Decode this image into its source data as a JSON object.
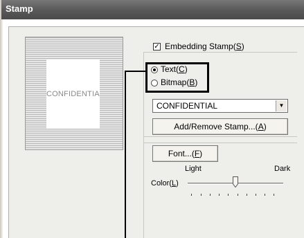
{
  "window": {
    "title": "Stamp"
  },
  "preview": {
    "text": "CONFIDENTIA"
  },
  "embedding": {
    "label_prefix": "Embedding Stamp(",
    "label_key": "S",
    "label_suffix": ")",
    "checked": true
  },
  "stamp_type": {
    "text_option": {
      "prefix": "Text(",
      "key": "C",
      "suffix": ")",
      "selected": true
    },
    "bitmap_option": {
      "prefix": "Bitmap(",
      "key": "B",
      "suffix": ")",
      "selected": false
    }
  },
  "stamp_select": {
    "value": "CONFIDENTIAL"
  },
  "add_remove_button": {
    "prefix": "Add/Remove Stamp...(",
    "key": "A",
    "suffix": ")"
  },
  "font_button": {
    "prefix": "Font...(",
    "key": "F",
    "suffix": ")"
  },
  "color_slider": {
    "min_label": "Light",
    "max_label": "Dark",
    "label_prefix": "Color(",
    "label_key": "L",
    "label_suffix": ")",
    "position_fraction": 0.5
  },
  "colors": {
    "title_bar": "#5a5a5a",
    "dialog_bg": "#eeeeea",
    "callout": "#000000"
  },
  "icons": {
    "checkbox_mark": "check-icon",
    "dropdown": "chevron-down-icon"
  }
}
